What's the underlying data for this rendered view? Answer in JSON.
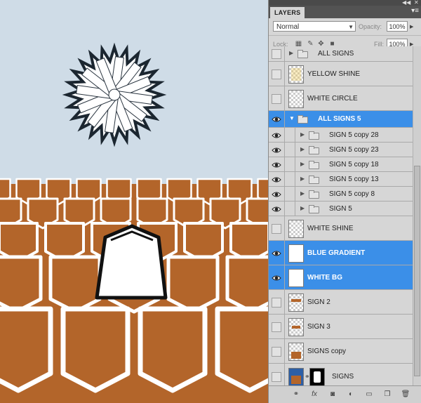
{
  "panel": {
    "tab_label": "LAYERS",
    "menu_icon": "panel-menu-icon",
    "blend_mode": "Normal",
    "opacity_label": "Opacity:",
    "opacity_value": "100%",
    "lock_label": "Lock:",
    "fill_label": "Fill:",
    "fill_value": "100%"
  },
  "layers": [
    {
      "name": "ALL SIGNS",
      "type": "group",
      "visible": false,
      "selected": false,
      "indent": 0
    },
    {
      "name": "YELLOW SHINE",
      "type": "layer",
      "visible": false,
      "selected": false,
      "indent": 0
    },
    {
      "name": "WHITE CIRCLE",
      "type": "layer",
      "visible": false,
      "selected": false,
      "indent": 0
    },
    {
      "name": "ALL SIGNS 5",
      "type": "group",
      "visible": true,
      "selected": true,
      "indent": 0
    },
    {
      "name": "SIGN 5 copy 28",
      "type": "group",
      "visible": true,
      "selected": false,
      "indent": 1
    },
    {
      "name": "SIGN 5 copy 23",
      "type": "group",
      "visible": true,
      "selected": false,
      "indent": 1
    },
    {
      "name": "SIGN 5 copy 18",
      "type": "group",
      "visible": true,
      "selected": false,
      "indent": 1
    },
    {
      "name": "SIGN 5 copy 13",
      "type": "group",
      "visible": true,
      "selected": false,
      "indent": 1
    },
    {
      "name": "SIGN 5 copy 8",
      "type": "group",
      "visible": true,
      "selected": false,
      "indent": 1
    },
    {
      "name": "SIGN 5",
      "type": "group",
      "visible": true,
      "selected": false,
      "indent": 1
    },
    {
      "name": "WHITE SHINE",
      "type": "layer",
      "visible": false,
      "selected": false,
      "indent": 0
    },
    {
      "name": "BLUE GRADIENT",
      "type": "layer",
      "visible": true,
      "selected": true,
      "indent": 0
    },
    {
      "name": "WHITE BG",
      "type": "layer",
      "visible": true,
      "selected": true,
      "indent": 0
    },
    {
      "name": "SIGN 2",
      "type": "layer",
      "visible": false,
      "selected": false,
      "indent": 0
    },
    {
      "name": "SIGN 3",
      "type": "layer",
      "visible": false,
      "selected": false,
      "indent": 0
    },
    {
      "name": "SIGNS copy",
      "type": "layer",
      "visible": false,
      "selected": false,
      "indent": 0
    },
    {
      "name": "SIGNS",
      "type": "layer",
      "visible": false,
      "selected": false,
      "indent": 0
    }
  ],
  "colors": {
    "selection": "#3b8fe8",
    "panel_bg": "#d6d6d6",
    "canvas_sky": "#cfdce7",
    "floor_brown": "#b3652a"
  },
  "bottom_icons": [
    "link-layers-icon",
    "fx-icon",
    "add-mask-icon",
    "adjustment-layer-icon",
    "new-group-icon",
    "new-layer-icon",
    "trash-icon"
  ]
}
